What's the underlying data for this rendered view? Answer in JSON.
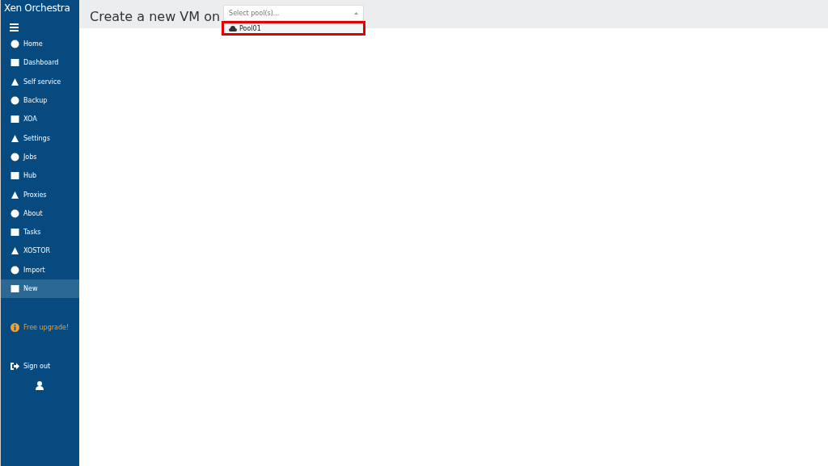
{
  "sidebar": {
    "title": "Xen Orchestra",
    "items": [
      {
        "label": "Home",
        "selected": false
      },
      {
        "label": "Dashboard",
        "selected": false
      },
      {
        "label": "Self service",
        "selected": false
      },
      {
        "label": "Backup",
        "selected": false
      },
      {
        "label": "XOA",
        "selected": false
      },
      {
        "label": "Settings",
        "selected": false
      },
      {
        "label": "Jobs",
        "selected": false
      },
      {
        "label": "Hub",
        "selected": false
      },
      {
        "label": "Proxies",
        "selected": false
      },
      {
        "label": "About",
        "selected": false
      },
      {
        "label": "Tasks",
        "selected": false
      },
      {
        "label": "XOSTOR",
        "selected": false
      },
      {
        "label": "Import",
        "selected": false
      },
      {
        "label": "New",
        "selected": true
      }
    ],
    "upgrade": "Free upgrade!",
    "sign_out": "Sign out"
  },
  "header": {
    "title": "Create a new VM on",
    "pool_select": {
      "placeholder": "Select pool(s)...",
      "options": [
        {
          "label": "Pool01",
          "highlighted": true
        }
      ]
    }
  }
}
